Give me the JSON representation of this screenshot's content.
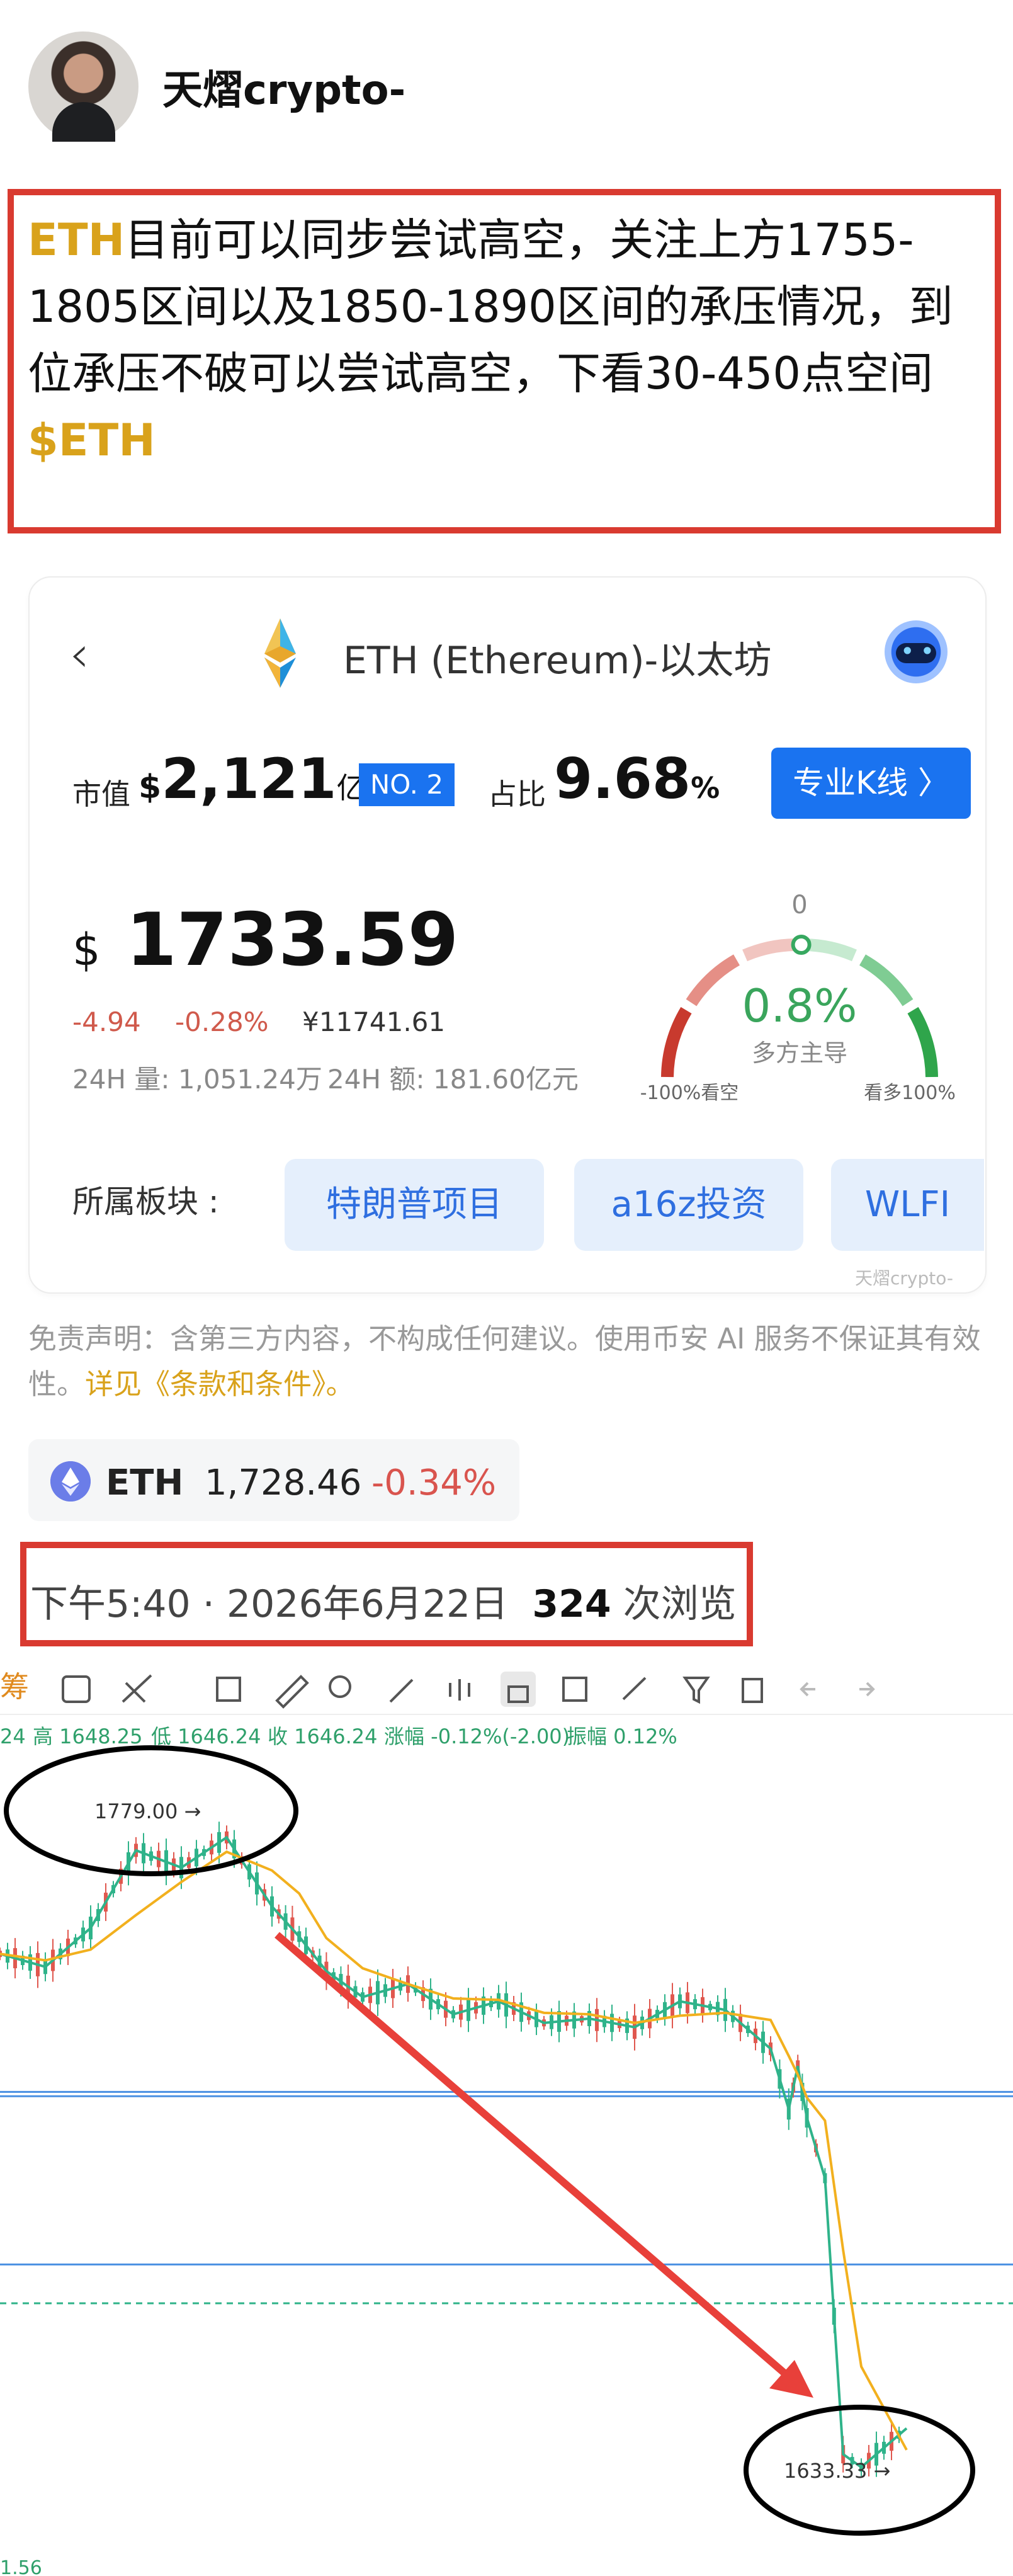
{
  "profile": {
    "username": "天熠crypto-"
  },
  "post": {
    "symbol_prefix": "ETH",
    "text": "目前可以同步尝试高空，关注上方1755-1805区间以及1850-1890区间的承压情况，到位承压不破可以尝试高空，下看30-450点空间",
    "tag": "$ETH"
  },
  "card": {
    "title": "ETH (Ethereum)-以太坊",
    "market_cap_label": "市值",
    "market_cap_currency": "$",
    "market_cap_value": "2,121",
    "market_cap_unit": "亿",
    "rank": "NO. 2",
    "share_label": "占比",
    "share_value": "9.68",
    "share_unit": "%",
    "kline_button": "专业K线 〉",
    "price_currency": "$",
    "price": "1733.59",
    "change_abs": "-4.94",
    "change_pct": "-0.28%",
    "price_cny": "¥11741.61",
    "volume_24h": "24H 量: 1,051.24万",
    "amount_24h": "24H 额: 181.60亿元",
    "gauge": {
      "top_label": "0",
      "value": "0.8%",
      "caption": "多方主导",
      "left_label": "-100%看空",
      "right_label": "看多100%",
      "level": 0.504
    },
    "sector_label": "所属板块 :",
    "sectors": [
      "特朗普项目",
      "a16z投资",
      "WLFI"
    ],
    "watermark": "天熠crypto-"
  },
  "disclaimer": {
    "text": "免责声明：含第三方内容，不构成任何建议。使用币安 AI 服务不保证其有效性。",
    "link": "详见《条款和条件》。"
  },
  "ticker": {
    "symbol": "ETH",
    "price": "1,728.46",
    "change": "-0.34%"
  },
  "meta": {
    "time": "下午5:40 · 2026年6月22日",
    "views": "324",
    "views_suffix": "次浏览"
  },
  "chart_toolbar": {
    "left_label": "筹"
  },
  "chart_info": {
    "prefix": "24",
    "high": "高 1648.25",
    "low": "低 1646.24",
    "close": "收 1646.24",
    "change": "涨幅 -0.12%(-2.00)",
    "amplitude": "振幅 0.12%"
  },
  "chart_data": {
    "type": "line",
    "annotations": {
      "high": "1779.00 →",
      "low": "1633.33 →"
    },
    "axis_fragment": "1.56",
    "x": [
      0,
      5,
      10,
      15,
      20,
      25,
      30,
      33,
      36,
      40,
      45,
      50,
      55,
      60,
      65,
      70,
      75,
      80,
      85,
      87,
      88,
      89,
      91,
      93,
      95,
      100
    ],
    "values": [
      1752,
      1749,
      1758,
      1776,
      1772,
      1779,
      1763,
      1756,
      1748,
      1742,
      1745,
      1738,
      1741,
      1736,
      1737,
      1735,
      1741,
      1739,
      1730,
      1716,
      1726,
      1714,
      1700,
      1636,
      1633,
      1642
    ],
    "series": [
      {
        "name": "",
        "values": [
          1752,
          1749,
          1758,
          1776,
          1772,
          1779,
          1763,
          1756,
          1748,
          1742,
          1745,
          1738,
          1741,
          1736,
          1737,
          1735,
          1741,
          1739,
          1730,
          1716,
          1726,
          1714,
          1700,
          1636,
          1633,
          1642
        ]
      }
    ],
    "ylim": [
      1625,
      1790
    ],
    "horizontal_levels": [
      1720,
      1719,
      1680
    ],
    "dashed_level": 1671
  }
}
